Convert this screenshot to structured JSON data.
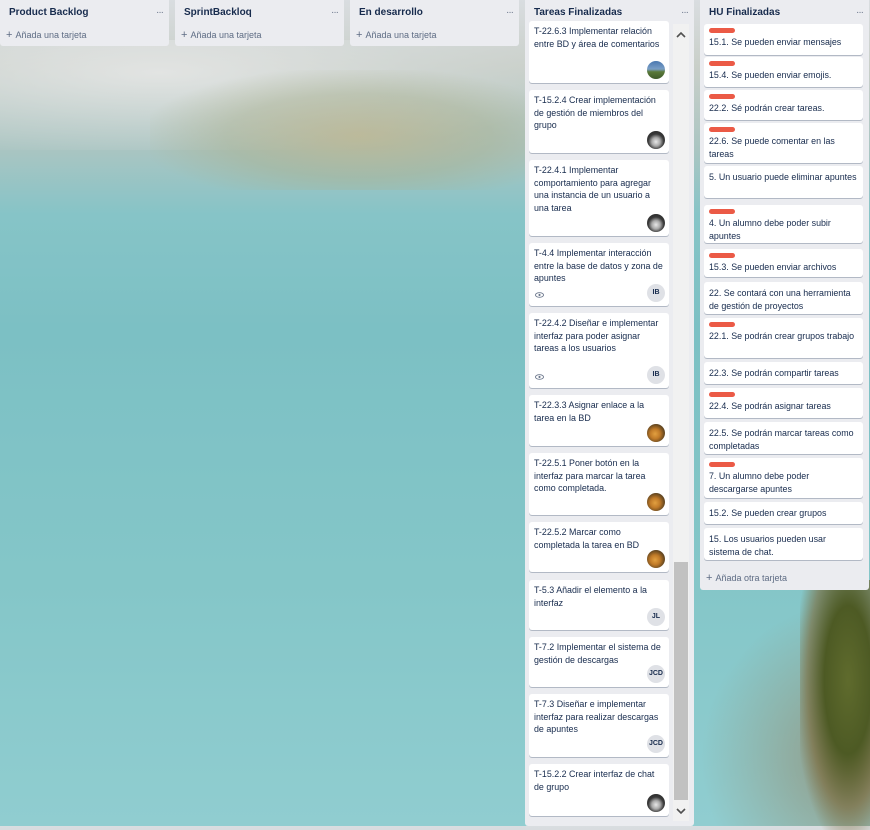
{
  "lists": {
    "product_backlog": {
      "title": "Product Backlog",
      "menu": "···",
      "add_label": "Añada una tarjeta",
      "add_icon": "plus-icon"
    },
    "sprint_backlog": {
      "title": "SprintBackloq",
      "menu": "···",
      "add_label": "Añada una tarjeta",
      "add_icon": "plus-icon"
    },
    "en_desarrollo": {
      "title": "En desarrollo",
      "menu": "···",
      "add_label": "Añada una tarjeta",
      "add_icon": "plus-icon"
    },
    "tareas_finalizadas": {
      "title": "Tareas Finalizadas",
      "menu": "···",
      "cards": [
        {
          "text": "T-22.6.3 Implementar relación entre BD y área de comentarios",
          "avatar": "landscape-photo"
        },
        {
          "text": "T-15.2.4 Crear implementación de gestión de miembros del grupo",
          "avatar": "cat-photo"
        },
        {
          "text": "T-22.4.1 Implementar comportamiento para agregar una instancia de un usuario a una tarea",
          "avatar": "cat-photo"
        },
        {
          "text": "T-4.4 Implementar interacción entre la base de datos y zona de apuntes",
          "avatar": "IB",
          "watch_icon": "eye-icon"
        },
        {
          "text": "T-22.4.2 Diseñar e implementar interfaz para poder asignar tareas a los usuarios",
          "avatar": "IB",
          "watch_icon": "eye-icon"
        },
        {
          "text": "T-22.3.3 Asignar enlace a la tarea en la BD",
          "avatar": "dog-photo"
        },
        {
          "text": "T-22.5.1 Poner botón en la interfaz para marcar la tarea como completada.",
          "avatar": "dog-photo"
        },
        {
          "text": "T-22.5.2 Marcar como completada la tarea en BD",
          "avatar": "dog-photo"
        },
        {
          "text": "T-5.3 Añadir el elemento a la interfaz",
          "avatar": "JL"
        },
        {
          "text": "T-7.2 Implementar el sistema de gestión de descargas",
          "avatar": "JCD"
        },
        {
          "text": "T-7.3 Diseñar e implementar interfaz para realizar descargas de apuntes",
          "avatar": "JCD"
        },
        {
          "text": "T-15.2.2 Crear interfaz de chat de grupo",
          "avatar": "cat-photo"
        }
      ]
    },
    "hu_finalizadas": {
      "title": "HU Finalizadas",
      "menu": "···",
      "add_label": "Añada otra tarjeta",
      "add_icon": "plus-icon",
      "cards": [
        {
          "text": "15.1. Se pueden enviar mensajes",
          "label_color": "#eb5a46"
        },
        {
          "text": "15.4. Se pueden enviar emojis.",
          "label_color": "#eb5a46"
        },
        {
          "text": "22.2. Sé podrán crear tareas.",
          "label_color": "#eb5a46"
        },
        {
          "text": "22.6. Se puede comentar en las tareas",
          "label_color": "#eb5a46"
        },
        {
          "text": "5. Un usuario puede eliminar apuntes",
          "label_color": ""
        },
        {
          "text": "4. Un alumno debe poder subir apuntes",
          "label_color": "#eb5a46"
        },
        {
          "text": "15.3. Se pueden enviar archivos",
          "label_color": "#eb5a46"
        },
        {
          "text": "22. Se contará con una herramienta de gestión de proyectos",
          "label_color": ""
        },
        {
          "text": "22.1. Se podrán crear grupos trabajo",
          "label_color": "#eb5a46"
        },
        {
          "text": "22.3. Se podrán compartir tareas",
          "label_color": ""
        },
        {
          "text": "22.4. Se podrán asignar tareas",
          "label_color": "#eb5a46"
        },
        {
          "text": "22.5. Se podrán marcar tareas como completadas",
          "label_color": ""
        },
        {
          "text": "7. Un alumno debe poder descargarse apuntes",
          "label_color": "#eb5a46"
        },
        {
          "text": "15.2. Se pueden crear grupos",
          "label_color": ""
        },
        {
          "text": "15. Los usuarios pueden usar sistema de chat.",
          "label_color": ""
        }
      ]
    }
  },
  "colors": {
    "label_red": "#eb5a46",
    "list_bg": "#ebecf0",
    "card_bg": "#ffffff"
  },
  "scrollbar": {
    "up_icon": "chevron-up-icon",
    "down_icon": "chevron-down-icon"
  }
}
